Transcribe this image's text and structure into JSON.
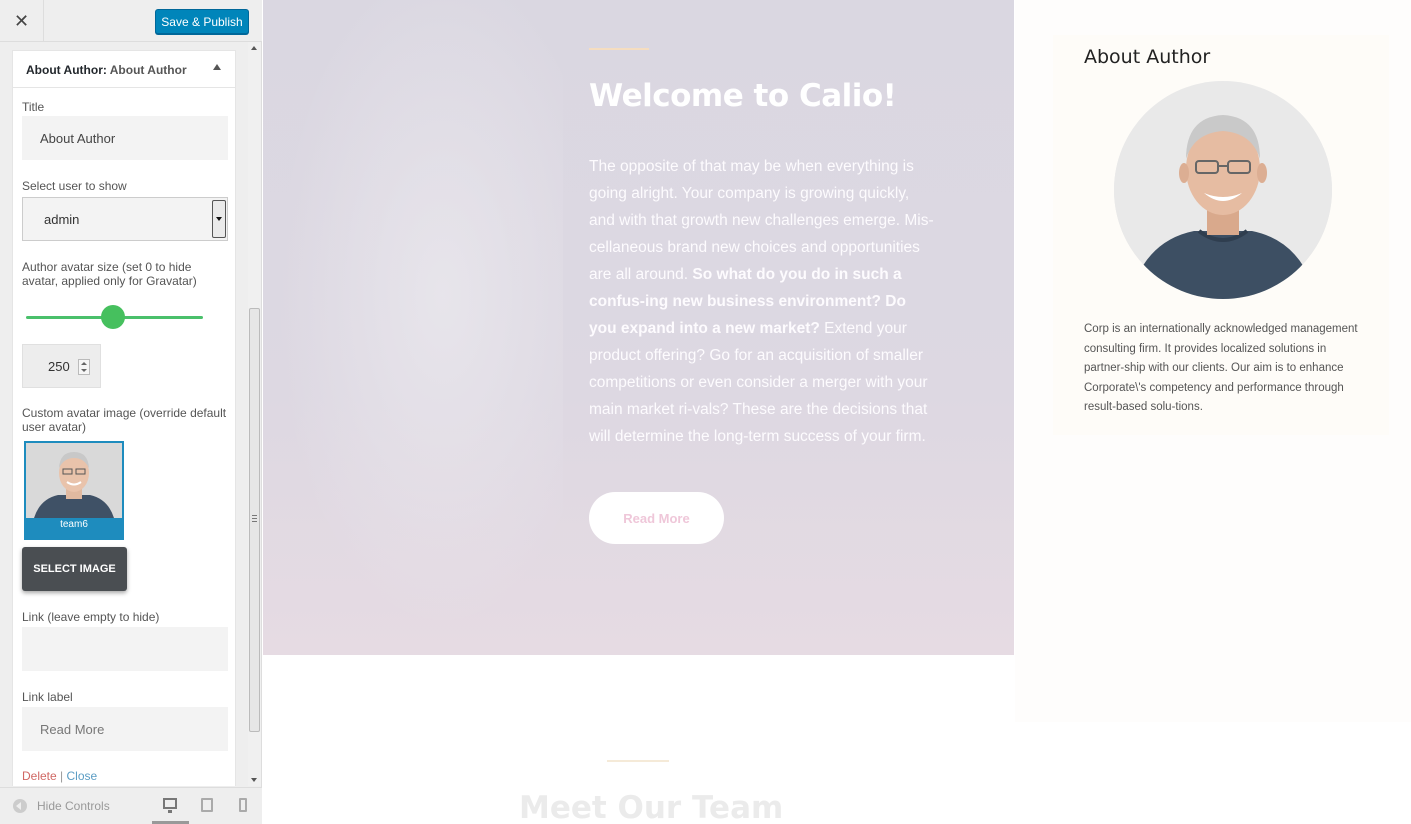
{
  "toolbar": {
    "close_label": "✕",
    "save_label": "Save & Publish"
  },
  "panel": {
    "head_prefix": "About Author:",
    "head_title": "About Author",
    "title_label": "Title",
    "title_value": "About Author",
    "user_label": "Select user to show",
    "user_value": "admin",
    "avatar_size_label": "Author avatar size (set 0 to hide avatar, applied only for Gravatar)",
    "avatar_size_value": "250",
    "custom_avatar_label": "Custom avatar image (override default user avatar)",
    "custom_avatar_caption": "team6",
    "select_image_label": "SELECT IMAGE",
    "link_label": "Link (leave empty to hide)",
    "link_value": "",
    "link_text_label": "Link label",
    "link_text_value": "Read More",
    "delete_label": "Delete",
    "separator": "|",
    "close_label": "Close"
  },
  "footer": {
    "hide_controls_label": "Hide Controls"
  },
  "hero": {
    "title": "Welcome to Calio!",
    "text_part1": "The opposite of that may be when everything is going alright. Your company is growing quickly, and with that growth new challenges emerge. Mis-cellaneous brand new choices and opportunities are all around.",
    "text_bold": "So what do you do in such a confus-ing new business environment? Do you expand into a new market?",
    "text_part2": "Extend your product offering? Go for an acquisition of smaller competitions or even consider a merger with your main market ri-vals? These are the decisions that will determine the long-term success of your firm.",
    "button_label": "Read More"
  },
  "team": {
    "title": "Meet Our Team"
  },
  "widget": {
    "title": "About Author",
    "description": "Corp is an internationally acknowledged management consulting firm. It provides localized solutions in partner-ship with our clients. Our aim is to enhance Corporate\\'s competency and performance through result-based solu-tions."
  },
  "colors": {
    "primary_button": "#0085ba",
    "slider": "#46c05e",
    "hero_bg": "#dad7e1",
    "delete_link": "#d06763",
    "close_link": "#5b9dc4"
  },
  "icons": [
    "close-icon",
    "collapse-caret-icon",
    "dropdown-arrow-icon",
    "spinner-icon",
    "hide-controls-icon",
    "desktop-icon",
    "tablet-icon",
    "mobile-icon"
  ]
}
